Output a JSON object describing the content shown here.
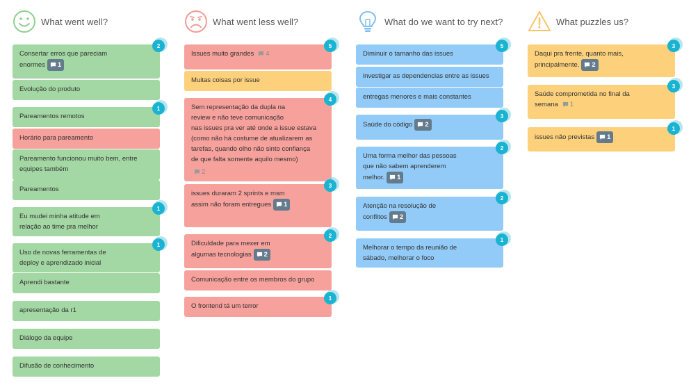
{
  "columns": [
    {
      "key": "well",
      "title": "What went well?",
      "icon": "smiley-happy-icon",
      "color": "#a3d7a3",
      "cards": [
        {
          "text": "Consertar erros que pareciam\nenormes",
          "votes": "2",
          "comments": "1",
          "comment_style": "solid"
        },
        {
          "text": "Evolução do produto"
        },
        {
          "text": "Pareamentos remotos",
          "votes": "1"
        },
        {
          "text": "Horário para pareamento",
          "variant": "red"
        },
        {
          "text": "Pareamento funcionou muito bem, entre\nequipes também"
        },
        {
          "text": "Pareamentos"
        },
        {
          "text": "Eu mudei minha atitude em\nrelação ao time pra melhor",
          "votes": "1"
        },
        {
          "text": "Uso de novas ferramentas de\ndeploy e aprendizado inicial",
          "votes": "1"
        },
        {
          "text": "Aprendi bastante"
        },
        {
          "text": "apresentação da r1"
        },
        {
          "text": "Diálogo da equipe"
        },
        {
          "text": "Difusão de conhecimento"
        }
      ]
    },
    {
      "key": "less",
      "title": "What went less well?",
      "icon": "smiley-sad-icon",
      "color": "#f7a19c",
      "cards": [
        {
          "text": "Issues muito grandes",
          "votes": "5",
          "comments": "4",
          "comment_style": "plain"
        },
        {
          "text": "Muitas coisas por issue",
          "variant": "yellow"
        },
        {
          "text": "Sem representação da dupla na\nreview e não teve comunicação\nnas issues pra ver até onde a issue estava\n(como não há costume de atualizarem as\ntarefas, quando olho não sinto confiança\nde que falta somente aquilo mesmo)",
          "votes": "4",
          "comments": "2",
          "comment_style": "plain"
        },
        {
          "text": "issues duraram 2 sprints e msm\nassim não foram entregues",
          "votes": "3",
          "comments": "1",
          "comment_style": "solid"
        },
        {
          "text": "Dificuldade para mexer em\nalgumas tecnologias",
          "votes": "2",
          "comments": "2",
          "comment_style": "solid"
        },
        {
          "text": "Comunicação entre os membros do grupo"
        },
        {
          "text": "O frontend tá um terror",
          "votes": "1"
        }
      ]
    },
    {
      "key": "try",
      "title": "What do we want to try next?",
      "icon": "lightbulb-icon",
      "color": "#92cbf7",
      "cards": [
        {
          "text": "Diminuir o tamanho das issues",
          "votes": "5"
        },
        {
          "text": "investigar as dependencias entre as issues"
        },
        {
          "text": "entregas menores e mais constantes"
        },
        {
          "text": "Saúde do código",
          "votes": "3",
          "comments": "2",
          "comment_style": "solid"
        },
        {
          "text": "Uma forma melhor das pessoas\nque não sabem aprenderem\nmelhor.",
          "votes": "2",
          "comments": "1",
          "comment_style": "solid"
        },
        {
          "text": "Atenção na resolução de\nconflitos",
          "votes": "2",
          "comments": "2",
          "comment_style": "solid"
        },
        {
          "text": "Melhorar o tempo da reunião de\nsábado, melhorar o foco",
          "votes": "1"
        }
      ]
    },
    {
      "key": "puzzle",
      "title": "What puzzles us?",
      "icon": "warning-icon",
      "color": "#fdd17c",
      "cards": [
        {
          "text": "Daqui pra frente, quanto mais,\nprincipalmente.",
          "votes": "3",
          "comments": "2",
          "comment_style": "solid"
        },
        {
          "text": "Saúde comprometida no final da\nsemana",
          "votes": "3",
          "comments": "1",
          "comment_style": "plain"
        },
        {
          "text": "issues não previstas",
          "votes": "1",
          "comments": "1",
          "comment_style": "solid"
        }
      ]
    }
  ]
}
